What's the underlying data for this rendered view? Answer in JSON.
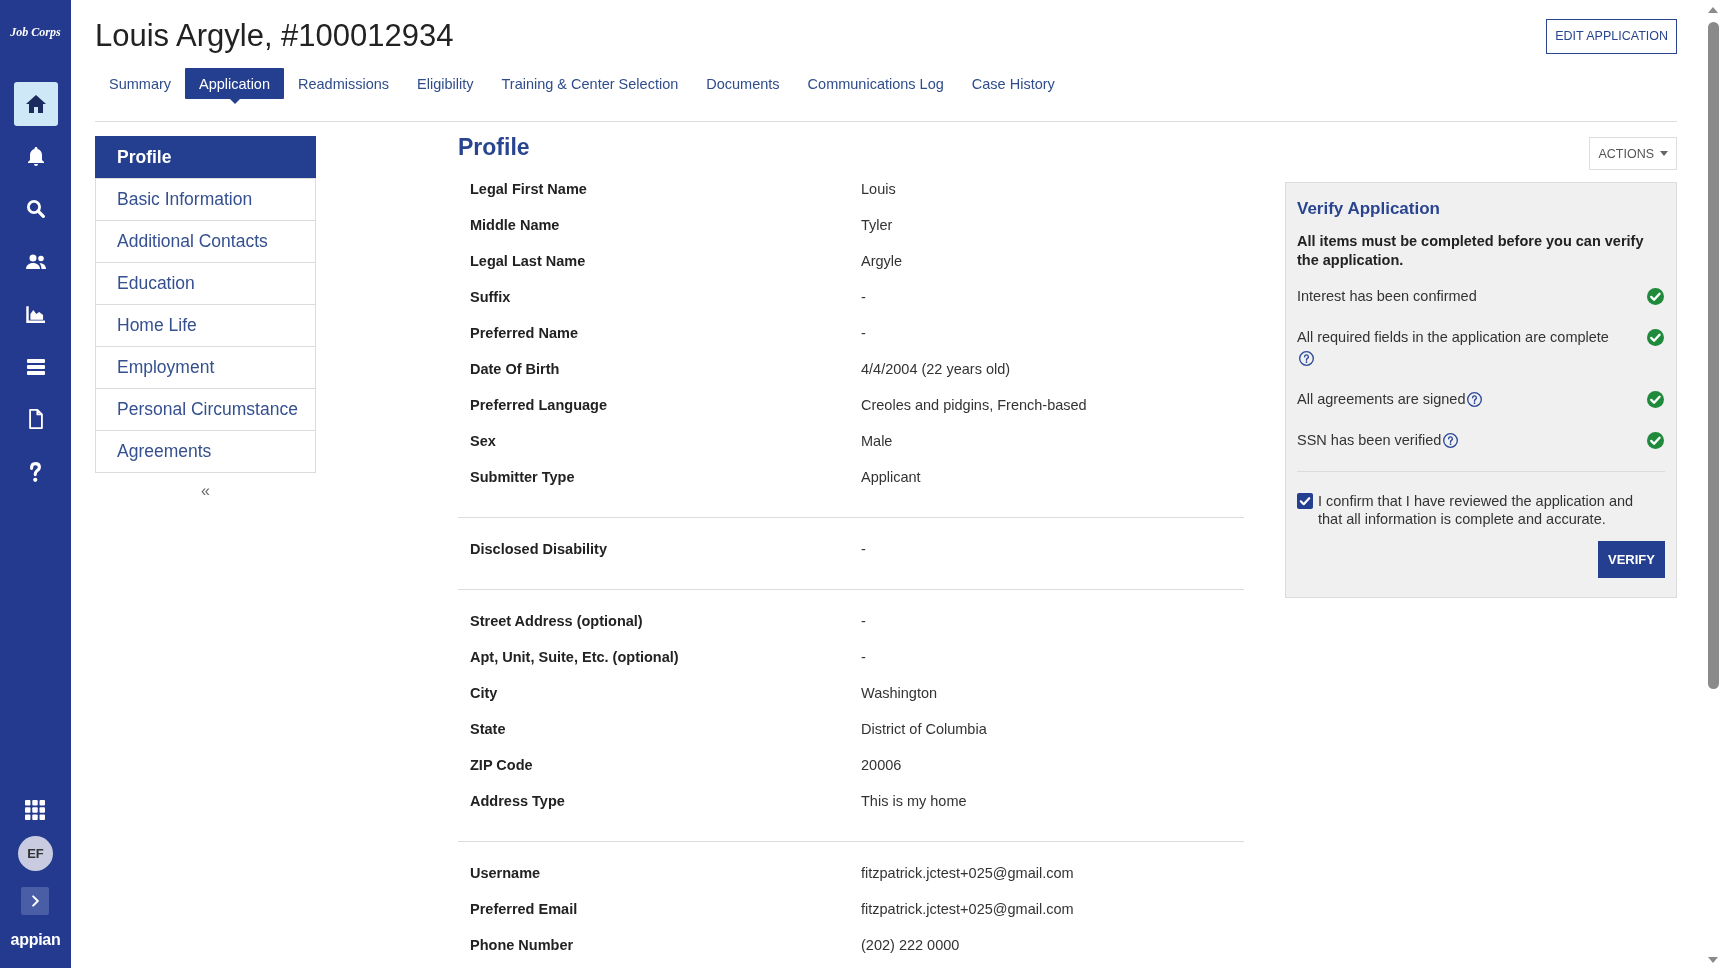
{
  "sidebar": {
    "logo": "Job Corps",
    "items": [
      {
        "kind": "home",
        "selected": true
      },
      {
        "kind": "bell",
        "selected": false
      },
      {
        "kind": "search",
        "selected": false
      },
      {
        "kind": "people",
        "selected": false
      },
      {
        "kind": "chart",
        "selected": false
      },
      {
        "kind": "list",
        "selected": false
      },
      {
        "kind": "document",
        "selected": false
      },
      {
        "kind": "help",
        "selected": false
      }
    ],
    "avatar": "EF",
    "brand": "appian"
  },
  "header": {
    "title": "Louis Argyle, #100012934",
    "edit_button": "EDIT APPLICATION"
  },
  "tabs": [
    {
      "label": "Summary",
      "selected": false
    },
    {
      "label": "Application",
      "selected": true
    },
    {
      "label": "Readmissions",
      "selected": false
    },
    {
      "label": "Eligibility",
      "selected": false
    },
    {
      "label": "Training & Center Selection",
      "selected": false
    },
    {
      "label": "Documents",
      "selected": false
    },
    {
      "label": "Communications Log",
      "selected": false
    },
    {
      "label": "Case History",
      "selected": false
    }
  ],
  "section_nav": {
    "items": [
      {
        "label": "Profile",
        "selected": true
      },
      {
        "label": "Basic Information",
        "selected": false
      },
      {
        "label": "Additional Contacts",
        "selected": false
      },
      {
        "label": "Education",
        "selected": false
      },
      {
        "label": "Home Life",
        "selected": false
      },
      {
        "label": "Employment",
        "selected": false
      },
      {
        "label": "Personal Circumstance",
        "selected": false
      },
      {
        "label": "Agreements",
        "selected": false
      }
    ],
    "collapse": "«"
  },
  "profile": {
    "heading": "Profile",
    "groups": [
      {
        "fields": [
          {
            "label": "Legal First Name",
            "value": "Louis"
          },
          {
            "label": "Middle Name",
            "value": "Tyler"
          },
          {
            "label": "Legal Last Name",
            "value": "Argyle"
          },
          {
            "label": "Suffix",
            "value": "-"
          },
          {
            "label": "Preferred Name",
            "value": "-"
          },
          {
            "label": "Date Of Birth",
            "value": "4/4/2004 (22 years old)"
          },
          {
            "label": "Preferred Language",
            "value": "Creoles and pidgins, French-based"
          },
          {
            "label": "Sex",
            "value": "Male"
          },
          {
            "label": "Submitter Type",
            "value": "Applicant"
          }
        ]
      },
      {
        "fields": [
          {
            "label": "Disclosed Disability",
            "value": "-"
          }
        ]
      },
      {
        "fields": [
          {
            "label": "Street Address (optional)",
            "value": "-"
          },
          {
            "label": "Apt, Unit, Suite, Etc. (optional)",
            "value": "-"
          },
          {
            "label": "City",
            "value": "Washington"
          },
          {
            "label": "State",
            "value": "District of Columbia"
          },
          {
            "label": "ZIP Code",
            "value": "20006"
          },
          {
            "label": "Address Type",
            "value": "This is my home"
          }
        ]
      },
      {
        "fields": [
          {
            "label": "Username",
            "value": "fitzpatrick.jctest+025@gmail.com"
          },
          {
            "label": "Preferred Email",
            "value": "fitzpatrick.jctest+025@gmail.com"
          },
          {
            "label": "Phone Number",
            "value": "(202) 222 0000"
          }
        ]
      }
    ]
  },
  "actions_button": "ACTIONS",
  "verify": {
    "title": "Verify Application",
    "instruction": "All items must be completed before you can verify the application.",
    "checks": [
      {
        "text": "Interest has been confirmed",
        "help": false,
        "complete": true
      },
      {
        "text": "All required fields in the application are complete",
        "help": true,
        "complete": true
      },
      {
        "text": "All agreements are signed",
        "help": true,
        "complete": true
      },
      {
        "text": "SSN has been verified",
        "help": true,
        "complete": true
      }
    ],
    "confirmation": {
      "text": "I confirm that I have reviewed the application and that all information is complete and accurate.",
      "checked": true
    },
    "button": "VERIFY"
  }
}
